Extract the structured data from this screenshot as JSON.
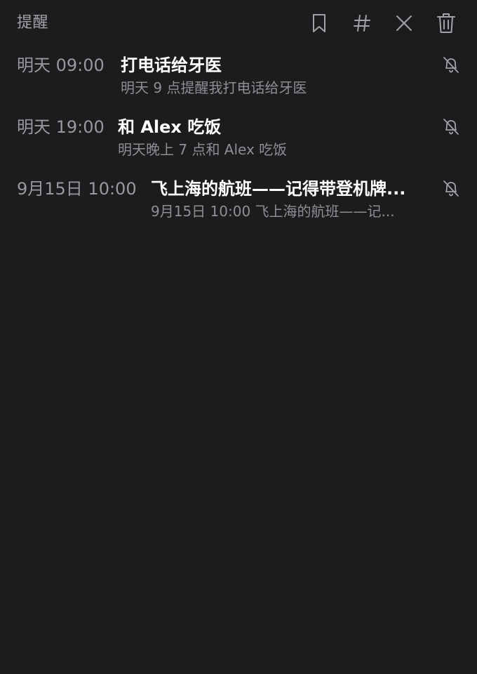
{
  "header": {
    "title": "提醒",
    "icons": [
      "bookmark-icon",
      "hashtag-icon",
      "close-icon",
      "trash-icon"
    ]
  },
  "colors": {
    "background": "#1c1c1e",
    "title": "#ffffff",
    "time": "#98989d",
    "subtitle": "#8e8e93",
    "icon": "#a1a1a6"
  },
  "reminders": [
    {
      "time": "明天 09:00",
      "title": "打电话给牙医",
      "subtitle": "明天 9 点提醒我打电话给牙医",
      "icon": "bell-off-icon"
    },
    {
      "time": "明天 19:00",
      "title": "和 Alex 吃饭",
      "subtitle": "明天晚上 7 点和 Alex 吃饭",
      "icon": "bell-off-icon"
    },
    {
      "time": "9月15日 10:00",
      "title": "飞上海的航班——记得带登机牌...",
      "subtitle": "9月15日 10:00 飞上海的航班——记...",
      "icon": "bell-off-icon"
    }
  ]
}
